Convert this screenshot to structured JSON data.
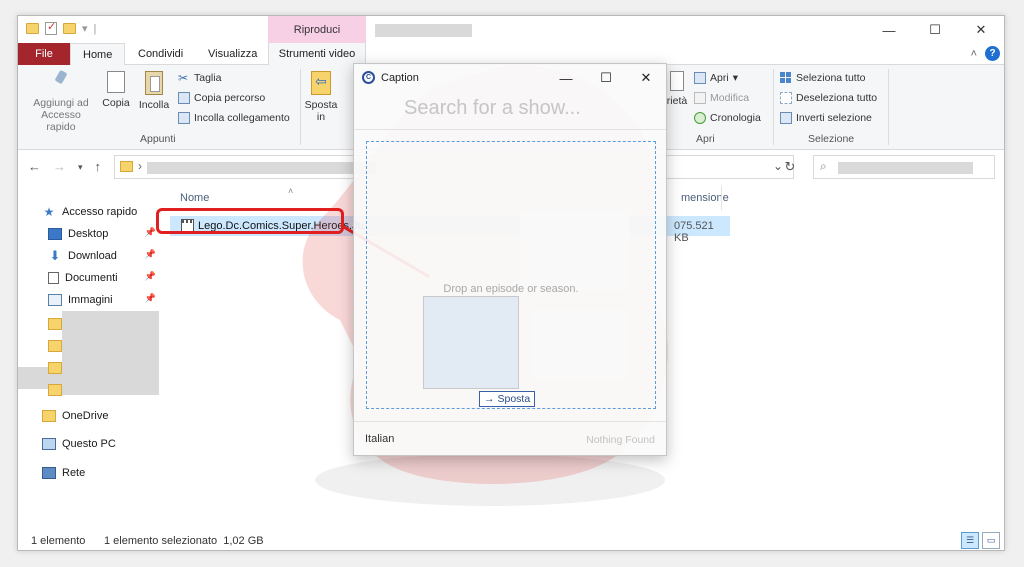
{
  "explorer": {
    "context_tab_top": "Riproduci",
    "tabs": {
      "file": "File",
      "home": "Home",
      "condividi": "Condividi",
      "visualizza": "Visualizza",
      "strumenti_video": "Strumenti video"
    },
    "ribbon": {
      "aggiungi": "Aggiungi ad\nAccesso rapido",
      "copia": "Copia",
      "incolla": "Incolla",
      "taglia": "Taglia",
      "copia_percorso": "Copia percorso",
      "incolla_collegamento": "Incolla collegamento",
      "appunti_label": "Appunti",
      "sposta": "Sposta\nin",
      "proprieta": "rietà",
      "apri": "Apri",
      "modifica": "Modifica",
      "cronologia": "Cronologia",
      "apri_label": "Apri",
      "seleziona_tutto": "Seleziona tutto",
      "deseleziona_tutto": "Deseleziona tutto",
      "inverti_selezione": "Inverti selezione",
      "selezione_label": "Selezione"
    },
    "nav": {
      "accesso_rapido": "Accesso rapido",
      "desktop": "Desktop",
      "download": "Download",
      "documenti": "Documenti",
      "immagini": "Immagini",
      "onedrive": "OneDrive",
      "questo_pc": "Questo PC",
      "rete": "Rete"
    },
    "columns": {
      "nome": "Nome",
      "dimensione": "mensione"
    },
    "file": {
      "name": "Lego.Dc.Comics.Super.Heroes.Ju",
      "size": "075.521 KB"
    },
    "status": {
      "count": "1 elemento",
      "selected": "1 elemento selezionato  1,02 GB"
    }
  },
  "caption": {
    "title": "Caption",
    "search_placeholder": "Search for a show...",
    "drop_text": "Drop an episode or season.",
    "drag_action": "Sposta",
    "language": "Italian",
    "result_status": "Nothing Found"
  },
  "colors": {
    "file_tab": "#a4262c",
    "context_tab": "#f8d0e6",
    "selection": "#cce8ff",
    "highlight_red": "#e02020",
    "dropzone_border": "#5b9be0"
  }
}
